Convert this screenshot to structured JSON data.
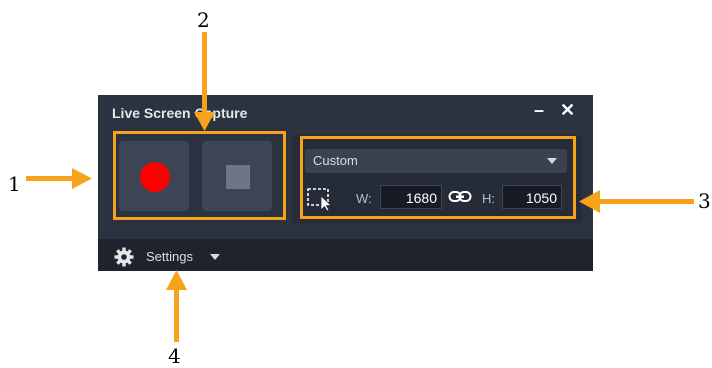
{
  "window": {
    "title": "Live Screen Capture",
    "minimize_glyph": "–",
    "close_glyph": "✕"
  },
  "record_controls": {
    "record_icon": "record-dot",
    "stop_icon": "stop-square",
    "record_color": "#ff0000"
  },
  "capture_area": {
    "preset_value": "Custom",
    "width_label": "W:",
    "width_value": "1680",
    "height_label": "H:",
    "height_value": "1050",
    "link_icon": "chain-link",
    "select_icon": "region-select-cursor"
  },
  "settings": {
    "label": "Settings",
    "icon": "gear"
  },
  "callouts": [
    "1",
    "2",
    "3",
    "4"
  ],
  "colors": {
    "accent": "#f7a21b",
    "panel_bg": "#2b3240",
    "settings_bg": "#1e232e"
  }
}
